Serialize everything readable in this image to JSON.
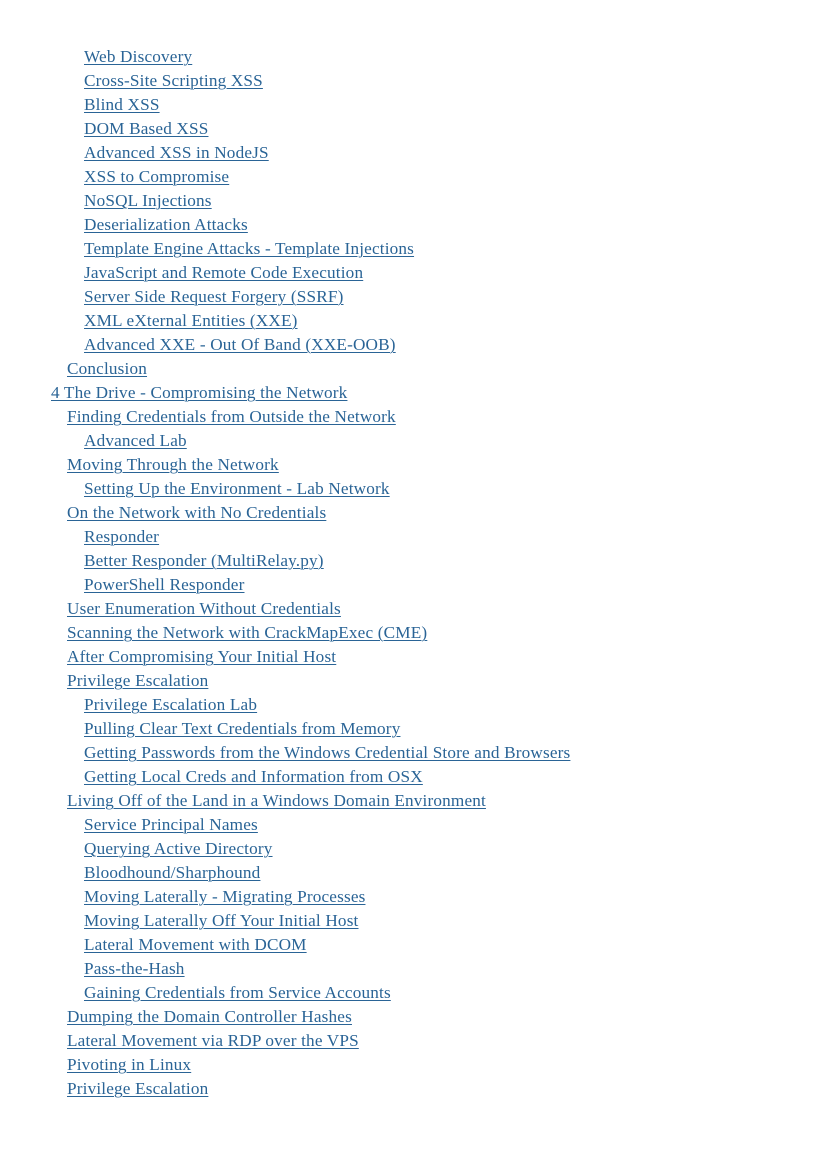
{
  "document": {
    "type": "pdf-table-of-contents",
    "page_background": "#ffffff",
    "link_color": "#2a6496"
  },
  "toc": {
    "entries": [
      {
        "label": "Web Discovery",
        "level": 2
      },
      {
        "label": "Cross-Site Scripting XSS",
        "level": 2
      },
      {
        "label": "Blind XSS",
        "level": 2
      },
      {
        "label": "DOM Based XSS",
        "level": 2
      },
      {
        "label": "Advanced XSS in NodeJS",
        "level": 2
      },
      {
        "label": "XSS to Compromise",
        "level": 2
      },
      {
        "label": "NoSQL Injections",
        "level": 2
      },
      {
        "label": "Deserialization Attacks",
        "level": 2
      },
      {
        "label": "Template Engine Attacks - Template Injections",
        "level": 2
      },
      {
        "label": "JavaScript and Remote Code Execution",
        "level": 2
      },
      {
        "label": "Server Side Request Forgery (SSRF)",
        "level": 2
      },
      {
        "label": "XML eXternal Entities (XXE)",
        "level": 2
      },
      {
        "label": "Advanced XXE - Out Of Band (XXE-OOB)",
        "level": 2
      },
      {
        "label": "Conclusion",
        "level": 1
      },
      {
        "label": "4 The Drive - Compromising the Network",
        "level": 0
      },
      {
        "label": "Finding Credentials from Outside the Network",
        "level": 1
      },
      {
        "label": "Advanced Lab",
        "level": 2
      },
      {
        "label": "Moving Through the Network",
        "level": 1
      },
      {
        "label": "Setting Up the Environment - Lab Network",
        "level": 2
      },
      {
        "label": "On the Network with No Credentials",
        "level": 1
      },
      {
        "label": "Responder",
        "level": 2
      },
      {
        "label": "Better Responder (MultiRelay.py)",
        "level": 2
      },
      {
        "label": "PowerShell Responder",
        "level": 2
      },
      {
        "label": "User Enumeration Without Credentials",
        "level": 1
      },
      {
        "label": "Scanning the Network with CrackMapExec (CME)",
        "level": 1
      },
      {
        "label": "After Compromising Your Initial Host",
        "level": 1
      },
      {
        "label": "Privilege Escalation",
        "level": 1
      },
      {
        "label": "Privilege Escalation Lab",
        "level": 2
      },
      {
        "label": "Pulling Clear Text Credentials from Memory",
        "level": 2
      },
      {
        "label": "Getting Passwords from the Windows Credential Store and Browsers",
        "level": 2
      },
      {
        "label": "Getting Local Creds and Information from OSX",
        "level": 2
      },
      {
        "label": "Living Off of the Land in a Windows Domain Environment",
        "level": 1
      },
      {
        "label": "Service Principal Names",
        "level": 2
      },
      {
        "label": "Querying Active Directory",
        "level": 2
      },
      {
        "label": "Bloodhound/Sharphound",
        "level": 2
      },
      {
        "label": "Moving Laterally - Migrating Processes",
        "level": 2
      },
      {
        "label": "Moving Laterally Off Your Initial Host",
        "level": 2
      },
      {
        "label": "Lateral Movement with DCOM",
        "level": 2
      },
      {
        "label": "Pass-the-Hash",
        "level": 2
      },
      {
        "label": "Gaining Credentials from Service Accounts",
        "level": 2
      },
      {
        "label": "Dumping the Domain Controller Hashes",
        "level": 1
      },
      {
        "label": "Lateral Movement via RDP over the VPS",
        "level": 1
      },
      {
        "label": "Pivoting in Linux",
        "level": 1
      },
      {
        "label": "Privilege Escalation",
        "level": 1
      }
    ]
  }
}
